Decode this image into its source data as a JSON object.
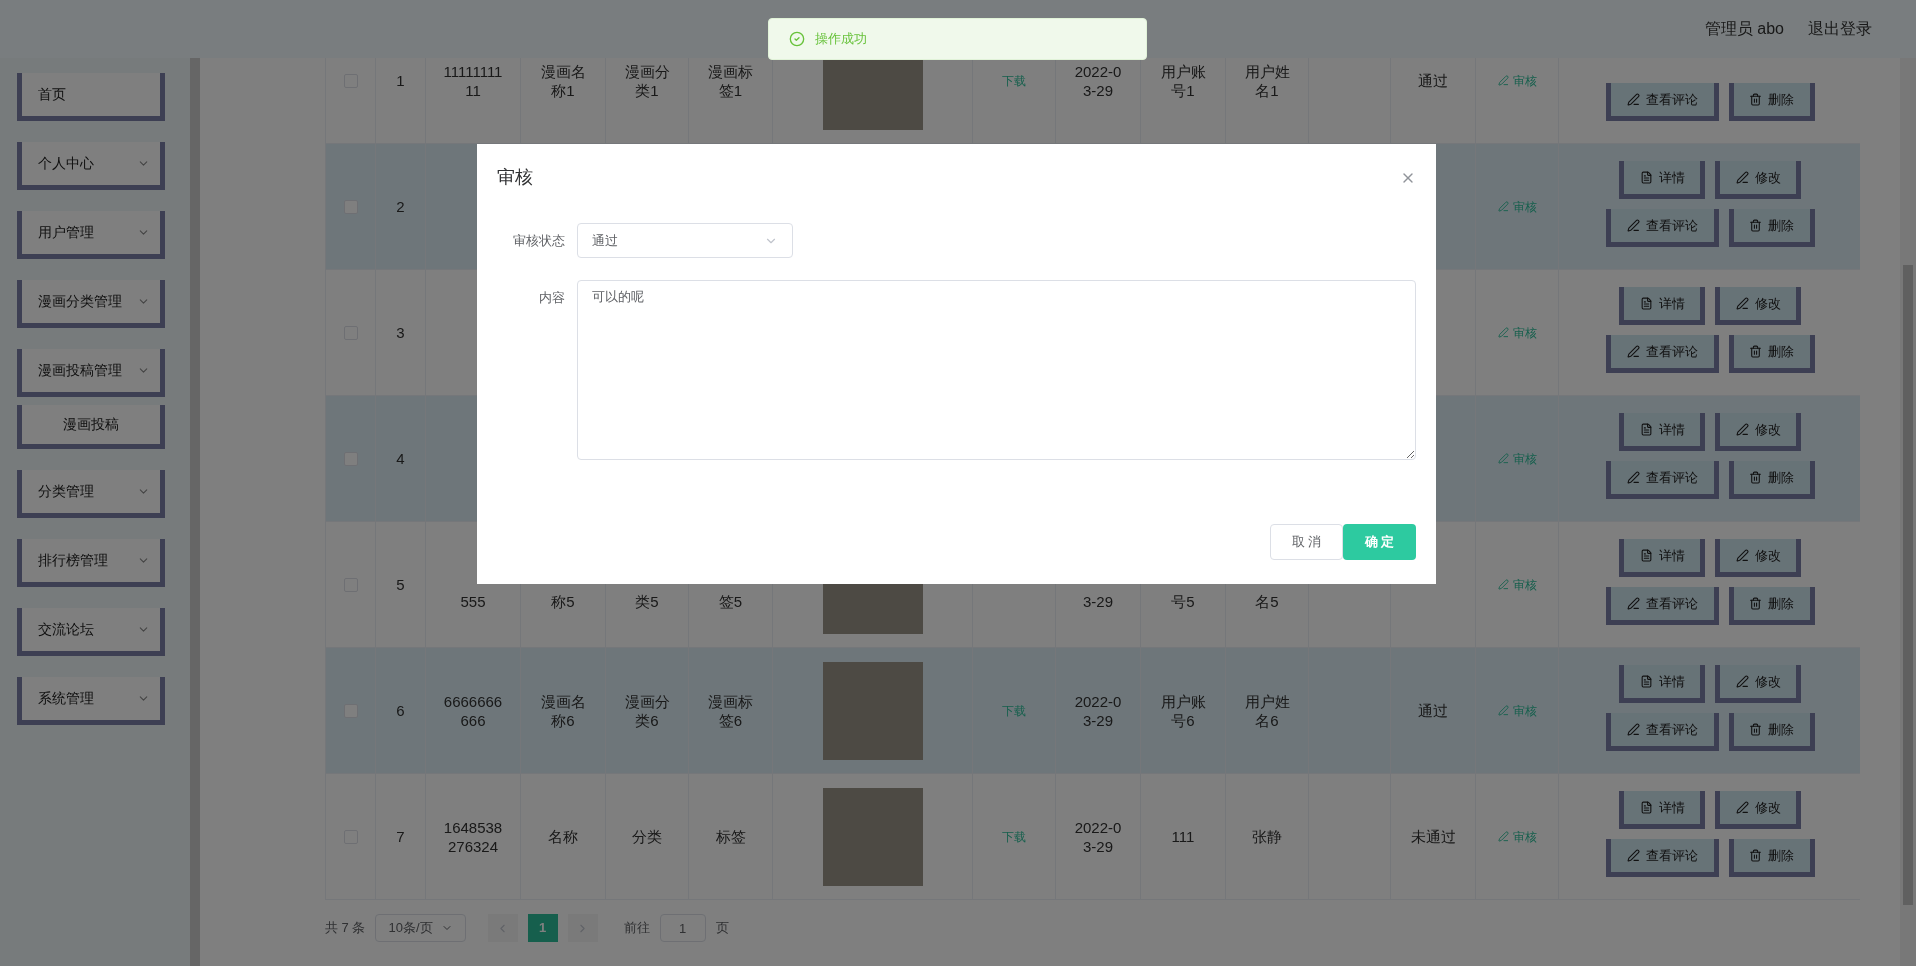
{
  "header": {
    "user": "管理员 abo",
    "logout": "退出登录"
  },
  "toast": {
    "message": "操作成功"
  },
  "sidebar": {
    "items": [
      {
        "label": "首页",
        "kind": "link"
      },
      {
        "label": "个人中心",
        "kind": "menu"
      },
      {
        "label": "用户管理",
        "kind": "menu"
      },
      {
        "label": "漫画分类管理",
        "kind": "menu"
      },
      {
        "label": "漫画投稿管理",
        "kind": "menu",
        "children": [
          {
            "label": "漫画投稿"
          }
        ]
      },
      {
        "label": "分类管理",
        "kind": "menu"
      },
      {
        "label": "排行榜管理",
        "kind": "menu"
      },
      {
        "label": "交流论坛",
        "kind": "menu"
      },
      {
        "label": "系统管理",
        "kind": "menu"
      }
    ]
  },
  "table": {
    "rows": [
      {
        "kind": "full",
        "checked": false,
        "index": "1",
        "id": "1111111111",
        "name": "漫画名称1",
        "category": "漫画分类1",
        "tag": "漫画标签1",
        "download": "下载",
        "date": "2022-03-29",
        "account": "用户账号1",
        "user_name": "用户姓名1",
        "status": "通过",
        "review": "审核",
        "actions": [
          {
            "kind": "comments",
            "label": "查看评论"
          },
          {
            "kind": "delete",
            "label": "删除"
          }
        ]
      },
      {
        "kind": "full",
        "checked": false,
        "index": "2",
        "review": "审核",
        "actions": [
          {
            "kind": "detail",
            "label": "详情"
          },
          {
            "kind": "edit",
            "label": "修改"
          },
          {
            "kind": "comments",
            "label": "查看评论"
          },
          {
            "kind": "delete",
            "label": "删除"
          }
        ]
      },
      {
        "kind": "full",
        "checked": false,
        "index": "3",
        "review": "审核",
        "actions": [
          {
            "kind": "detail",
            "label": "详情"
          },
          {
            "kind": "edit",
            "label": "修改"
          },
          {
            "kind": "comments",
            "label": "查看评论"
          },
          {
            "kind": "delete",
            "label": "删除"
          }
        ]
      },
      {
        "kind": "full",
        "checked": false,
        "index": "4",
        "review": "审核",
        "actions": [
          {
            "kind": "detail",
            "label": "详情"
          },
          {
            "kind": "edit",
            "label": "修改"
          },
          {
            "kind": "comments",
            "label": "查看评论"
          },
          {
            "kind": "delete",
            "label": "删除"
          }
        ]
      },
      {
        "kind": "lower",
        "checked": false,
        "index": "5",
        "id": "555",
        "name": "称5",
        "category": "类5",
        "tag": "签5",
        "date": "3-29",
        "account": "号5",
        "user_name": "名5",
        "review": "审核",
        "actions": [
          {
            "kind": "detail",
            "label": "详情"
          },
          {
            "kind": "edit",
            "label": "修改"
          },
          {
            "kind": "comments",
            "label": "查看评论"
          },
          {
            "kind": "delete",
            "label": "删除"
          }
        ]
      },
      {
        "kind": "full",
        "checked": false,
        "index": "6",
        "id": "6666666666",
        "name": "漫画名称6",
        "category": "漫画分类6",
        "tag": "漫画标签6",
        "download": "下载",
        "date": "2022-03-29",
        "account": "用户账号6",
        "user_name": "用户姓名6",
        "status": "通过",
        "review": "审核",
        "actions": [
          {
            "kind": "detail",
            "label": "详情"
          },
          {
            "kind": "edit",
            "label": "修改"
          },
          {
            "kind": "comments",
            "label": "查看评论"
          },
          {
            "kind": "delete",
            "label": "删除"
          }
        ]
      },
      {
        "kind": "full",
        "checked": false,
        "index": "7",
        "id": "1648538276324",
        "name": "名称",
        "category": "分类",
        "tag": "标签",
        "download": "下载",
        "date": "2022-03-29",
        "account": "111",
        "user_name": "张静",
        "status": "未通过",
        "review": "审核",
        "actions": [
          {
            "kind": "detail",
            "label": "详情"
          },
          {
            "kind": "edit",
            "label": "修改"
          },
          {
            "kind": "comments",
            "label": "查看评论"
          },
          {
            "kind": "delete",
            "label": "删除"
          }
        ]
      }
    ]
  },
  "pagination": {
    "total": "共 7 条",
    "page_size": "10条/页",
    "pages": [
      {
        "label": "1",
        "selected": true
      }
    ],
    "goto_label": "前往",
    "goto_value": "1",
    "goto_suffix": "页"
  },
  "dialog": {
    "title": "审核",
    "fields": [
      {
        "kind": "select",
        "label": "审核状态",
        "value": "通过"
      },
      {
        "kind": "textarea",
        "label": "内容",
        "value": "可以的呢"
      }
    ],
    "buttons": [
      {
        "kind": "secondary",
        "label": "取 消"
      },
      {
        "kind": "primary",
        "label": "确 定"
      }
    ]
  }
}
